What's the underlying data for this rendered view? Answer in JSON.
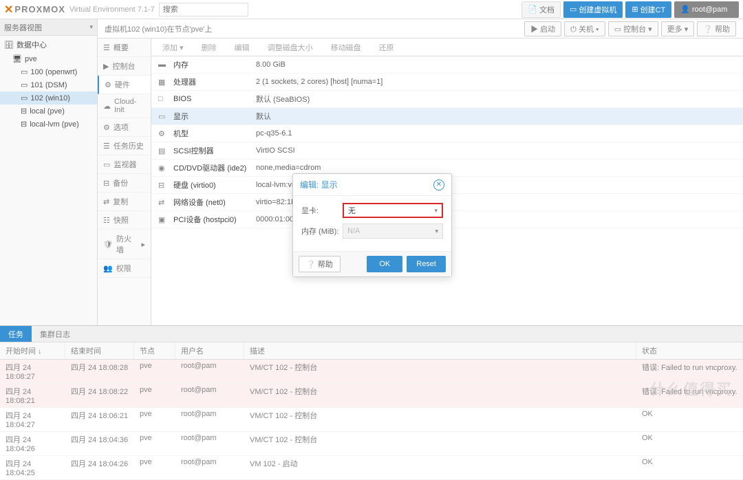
{
  "header": {
    "logo_brand": "PROXMOX",
    "ve_text": "Virtual Environment 7.1-7",
    "search_placeholder": "搜索",
    "btn_doc": "文档",
    "btn_create_vm": "创建虚拟机",
    "btn_create_ct": "创建CT",
    "btn_user": "root@pam"
  },
  "sidebar": {
    "title": "服务器视图",
    "datacenter": "数据中心",
    "node": "pve",
    "vm100": "100 (openwrt)",
    "vm101": "101 (DSM)",
    "vm102": "102 (win10)",
    "local": "local (pve)",
    "localvm": "local-lvm (pve)"
  },
  "crumb": {
    "text": "虚拟机102 (win10)在节点'pve'上",
    "btn_start": "启动",
    "btn_shutdown": "关机",
    "btn_console": "控制台",
    "btn_more": "更多",
    "btn_help": "帮助"
  },
  "menu": {
    "summary": "概要",
    "console": "控制台",
    "hardware": "硬件",
    "cloudinit": "Cloud-Init",
    "options": "选项",
    "taskhistory": "任务历史",
    "monitor": "监视器",
    "backup": "备份",
    "replication": "复制",
    "snapshot": "快照",
    "firewall": "防火墙",
    "permissions": "权限"
  },
  "toolbar": {
    "add": "添加",
    "remove": "删除",
    "edit": "编辑",
    "resize": "调整磁盘大小",
    "move": "移动磁盘",
    "revert": "还原"
  },
  "hardware": [
    {
      "icon": "▬",
      "name": "内存",
      "val": "8.00 GiB"
    },
    {
      "icon": "▦",
      "name": "处理器",
      "val": "2 (1 sockets, 2 cores) [host] [numa=1]"
    },
    {
      "icon": "□",
      "name": "BIOS",
      "val": "默认 (SeaBIOS)"
    },
    {
      "icon": "▭",
      "name": "显示",
      "val": "默认",
      "sel": true
    },
    {
      "icon": "⚙",
      "name": "机型",
      "val": "pc-q35-6.1"
    },
    {
      "icon": "▤",
      "name": "SCSI控制器",
      "val": "VirtIO SCSI"
    },
    {
      "icon": "◉",
      "name": "CD/DVD驱动器 (ide2)",
      "val": "none,media=cdrom"
    },
    {
      "icon": "⊟",
      "name": "硬盘 (virtio0)",
      "val": "local-lvm:vm-102-disk-0,size=32G"
    },
    {
      "icon": "⇄",
      "name": "网络设备 (net0)",
      "val": "virtio=82:1F:44:3F:17:24,bridge=vmbr0,firewall=1"
    },
    {
      "icon": "▣",
      "name": "PCI设备 (hostpci0)",
      "val": "0000:01:00,pcie=1,x-vga=1"
    }
  ],
  "modal": {
    "title": "编辑: 显示",
    "label_card": "显卡:",
    "value_card": "无",
    "label_mem": "内存 (MiB):",
    "value_mem": "N/A",
    "btn_help": "帮助",
    "btn_ok": "OK",
    "btn_reset": "Reset"
  },
  "tasktabs": {
    "tasks": "任务",
    "cluster": "集群日志"
  },
  "taskhead": {
    "start": "开始时间 ↓",
    "end": "结束时间",
    "node": "节点",
    "user": "用户名",
    "desc": "描述",
    "status": "状态"
  },
  "tasks": [
    {
      "start": "四月 24 18:08:27",
      "end": "四月 24 18:08:28",
      "node": "pve",
      "user": "root@pam",
      "desc": "VM/CT 102 - 控制台",
      "status": "错误: Failed to run vncproxy.",
      "err": true
    },
    {
      "start": "四月 24 18:08:21",
      "end": "四月 24 18:08:22",
      "node": "pve",
      "user": "root@pam",
      "desc": "VM/CT 102 - 控制台",
      "status": "错误: Failed to run vncproxy.",
      "err": true
    },
    {
      "start": "四月 24 18:04:27",
      "end": "四月 24 18:06:21",
      "node": "pve",
      "user": "root@pam",
      "desc": "VM/CT 102 - 控制台",
      "status": "OK"
    },
    {
      "start": "四月 24 18:04:26",
      "end": "四月 24 18:04:36",
      "node": "pve",
      "user": "root@pam",
      "desc": "VM/CT 102 - 控制台",
      "status": "OK"
    },
    {
      "start": "四月 24 18:04:25",
      "end": "四月 24 18:04:26",
      "node": "pve",
      "user": "root@pam",
      "desc": "VM 102 - 启动",
      "status": "OK"
    }
  ],
  "watermark": "什么值得买"
}
